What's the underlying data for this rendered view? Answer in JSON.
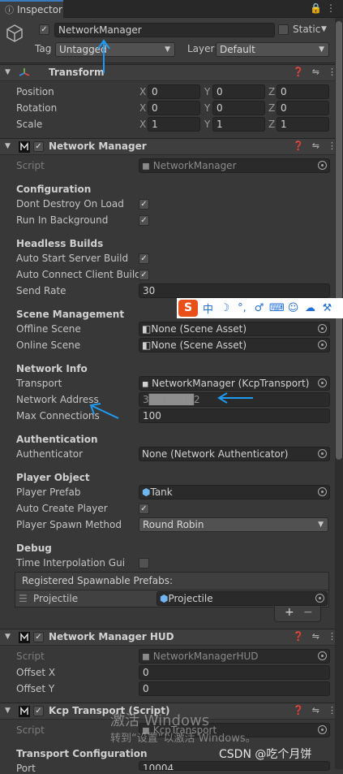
{
  "tab": {
    "icon": "info-icon",
    "title": "Inspector"
  },
  "gameobject": {
    "name": "NetworkManager",
    "static_label": "Static",
    "tag_label": "Tag",
    "tag_value": "Untagged",
    "layer_label": "Layer",
    "layer_value": "Default"
  },
  "transform": {
    "title": "Transform",
    "position": {
      "label": "Position",
      "x": "0",
      "y": "0",
      "z": "0"
    },
    "rotation": {
      "label": "Rotation",
      "x": "0",
      "y": "0",
      "z": "0"
    },
    "scale": {
      "label": "Scale",
      "x": "1",
      "y": "1",
      "z": "1"
    }
  },
  "axis": {
    "x": "X",
    "y": "Y",
    "z": "Z"
  },
  "network_manager": {
    "title": "Network Manager",
    "script_label": "Script",
    "script_value": "NetworkManager",
    "configuration": "Configuration",
    "dont_destroy": "Dont Destroy On Load",
    "run_background": "Run In Background",
    "headless": "Headless Builds",
    "auto_server": "Auto Start Server Build",
    "auto_client": "Auto Connect Client Build",
    "send_rate_label": "Send Rate",
    "send_rate": "30",
    "scene_mgmt": "Scene Management",
    "offline_scene_label": "Offline Scene",
    "offline_scene": "None (Scene Asset)",
    "online_scene_label": "Online Scene",
    "online_scene": "None (Scene Asset)",
    "network_info": "Network Info",
    "transport_label": "Transport",
    "transport": "NetworkManager (KcpTransport)",
    "address_label": "Network Address",
    "address": "3██████2",
    "max_conn_label": "Max Connections",
    "max_conn": "100",
    "authentication": "Authentication",
    "authenticator_label": "Authenticator",
    "authenticator": "None (Network Authenticator)",
    "player_object": "Player Object",
    "player_prefab_label": "Player Prefab",
    "player_prefab": "Tank",
    "auto_create_label": "Auto Create Player",
    "spawn_method_label": "Player Spawn Method",
    "spawn_method": "Round Robin",
    "debug": "Debug",
    "time_interp_label": "Time Interpolation Gui",
    "spawnable_header": "Registered Spawnable Prefabs:",
    "spawnable_item_label": "Projectile",
    "spawnable_item_value": "Projectile",
    "add": "+",
    "remove": "−"
  },
  "hud": {
    "title": "Network Manager HUD",
    "script_label": "Script",
    "script_value": "NetworkManagerHUD",
    "offset_x_label": "Offset X",
    "offset_x": "0",
    "offset_y_label": "Offset Y",
    "offset_y": "0"
  },
  "kcp": {
    "title": "Kcp Transport (Script)",
    "script_label": "Script",
    "script_value": "KcpTransport",
    "transport_config": "Transport Configuration",
    "port_label": "Port",
    "port_value": "10004"
  },
  "ime": [
    "中",
    "☽",
    "°,",
    "♂",
    "⌨",
    "☺",
    "☁",
    "⚒"
  ],
  "ime_logo": "S",
  "watermark": {
    "line1": "激活 Windows",
    "line2": "转到“设置”以激活 Windows。",
    "csdn": "CSDN @吃个月饼"
  },
  "colors": {
    "accent": "#3a79bb",
    "annotation": "#1e9bf0",
    "sogou": "#e8501a"
  }
}
